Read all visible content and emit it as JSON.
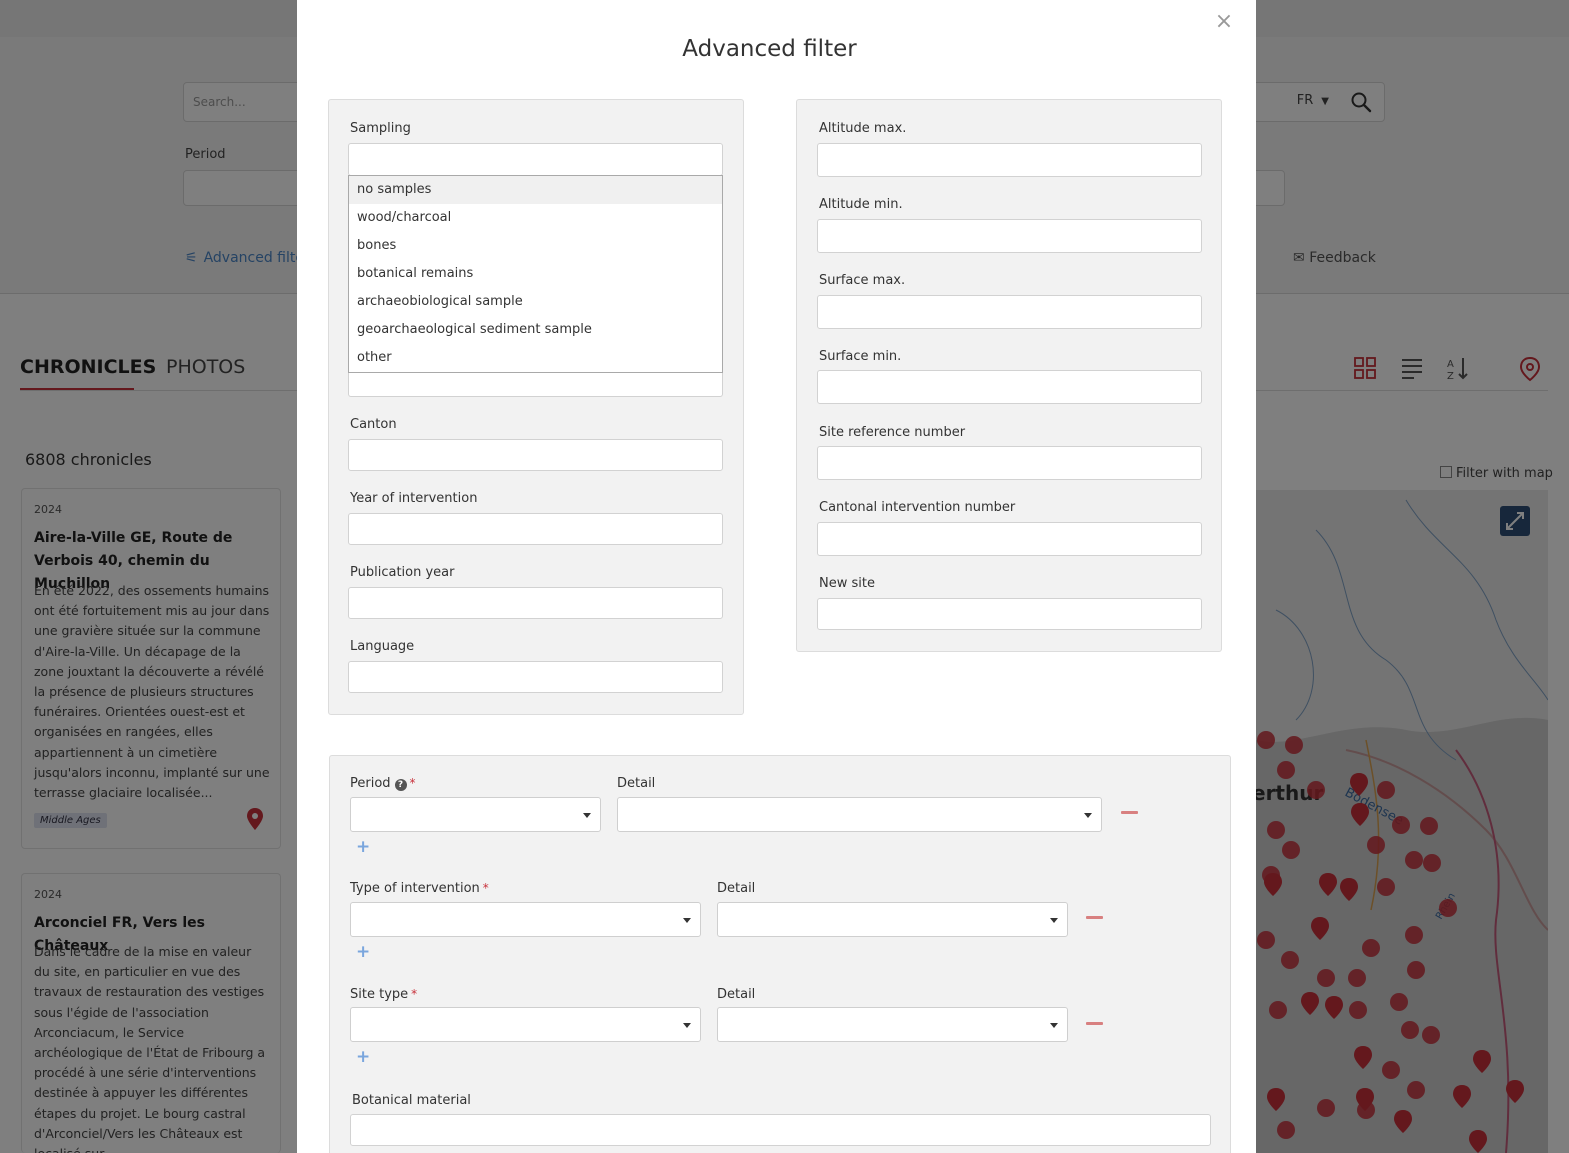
{
  "background": {
    "search": {
      "placeholder": "Search..."
    },
    "language": "FR",
    "period_label": "Period",
    "advanced_filter_link": "Advanced filte",
    "feedback_link": "Feedback",
    "tabs": [
      "CHRONICLES",
      "PHOTOS"
    ],
    "count": "6808 chronicles",
    "filter_with_map": "Filter with map",
    "cards": [
      {
        "year": "2024",
        "title": "Aire-la-Ville GE, Route de Verbois 40, chemin du Muchillon",
        "text": "En été 2022, des ossements humains ont été fortuitement mis au jour dans une gravière située sur la commune d'Aire-la-Ville. Un décapage de la zone jouxtant la découverte a révélé la présence de plusieurs structures funéraires. Orientées ouest-est et organisées en rangées, elles appartiennent à un cimetière jusqu'alors inconnu, implanté sur une terrasse glaciaire localisée...",
        "tag": "Middle Ages"
      },
      {
        "year": "2024",
        "title": "Arconciel FR, Vers les Châteaux",
        "text": "Dans le cadre de la mise en valeur du site, en particulier en vue des travaux de restauration des vestiges sous l'égide de l'association Arconciacum, le Service archéologique de l'État de Fribourg a procédé à une série d'interventions destinée à appuyer les différentes étapes du projet. Le bourg castral d'Arconciel/Vers les Châteaux est localisé sur..."
      }
    ],
    "map_labels": {
      "lake": "Bodensee",
      "city": "erthur",
      "river": "Rhein"
    }
  },
  "modal": {
    "title": "Advanced filter",
    "close": "×",
    "left": {
      "sampling_label": "Sampling",
      "sampling_options": [
        "no samples",
        "wood/charcoal",
        "bones",
        "botanical remains",
        "archaeobiological sample",
        "geoarchaeological sediment sample",
        "other"
      ],
      "canton_label": "Canton",
      "year_label": "Year of intervention",
      "publication_label": "Publication year",
      "language_label": "Language"
    },
    "right": {
      "altitude_max": "Altitude max.",
      "altitude_min": "Altitude min.",
      "surface_max": "Surface max.",
      "surface_min": "Surface min.",
      "site_ref": "Site reference number",
      "cantonal_num": "Cantonal intervention number",
      "new_site": "New site"
    },
    "bottom": {
      "period_label": "Period",
      "detail_label": "Detail",
      "type_label": "Type of intervention",
      "site_type_label": "Site type",
      "botanical_label": "Botanical material",
      "required_mark": "*",
      "help_mark": "?",
      "plus": "+"
    }
  },
  "colors": {
    "accent_red": "#c8303a",
    "link_blue": "#4a86c8",
    "panel_bg": "#f2f2f2"
  }
}
